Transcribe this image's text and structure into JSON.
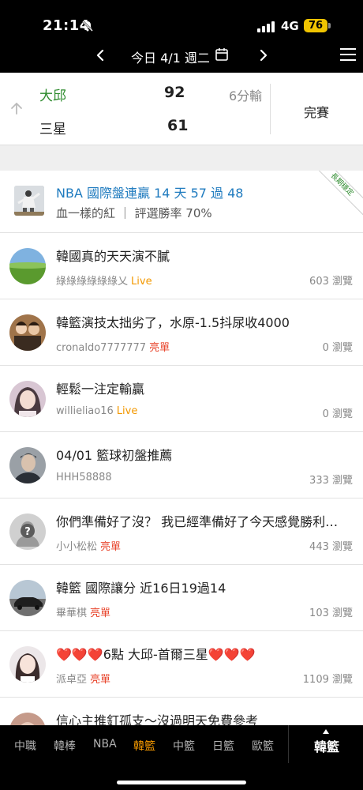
{
  "status_bar": {
    "time": "21:14",
    "network": "4G",
    "battery": "76",
    "accent": "#f0c400"
  },
  "date_nav": {
    "date_label": "今日 4/1 週二",
    "icons": [
      "chevron-left-icon",
      "calendar-icon",
      "chevron-right-icon",
      "menu-icon"
    ]
  },
  "game": {
    "team1": "大邱",
    "score1": "92",
    "team2": "三星",
    "score2": "61",
    "margin": "6分輸",
    "status": "完賽",
    "team1_color": "#2e8b2e"
  },
  "featured": {
    "title": "NBA 國際盤連贏 14 天 57 過 48",
    "subtitle": "血一樣的紅 ｜ 評選勝率 70%",
    "ribbon": "長期穩定",
    "title_color": "#1f7bbf"
  },
  "posts": [
    {
      "title": "韓國真的天天演不膩",
      "author": "綠綠綠綠綠綠乂",
      "tag": "Live",
      "tag_color": "#f39800",
      "views": "603 瀏覽"
    },
    {
      "title": "韓籃演技太拙劣了，水原-1.5抖尿收4000",
      "author": "cronaldo7777777",
      "tag": "亮單",
      "tag_color": "#e8452c",
      "views": "0 瀏覽"
    },
    {
      "title": "輕鬆一注定輸贏",
      "author": "willieliao16",
      "tag": "Live",
      "tag_color": "#f39800",
      "views": "0 瀏覽"
    },
    {
      "title": "04/01 籃球初盤推薦",
      "author": "HHH58888",
      "tag": "",
      "tag_color": "#888888",
      "views": "333 瀏覽"
    },
    {
      "title": "你們準備好了沒？  我已經準備好了今天感覺勝利…",
      "author": "小小松松",
      "tag": "亮單",
      "tag_color": "#e8452c",
      "views": "443 瀏覽"
    },
    {
      "title": "韓籃 國際讓分 近16日19過14",
      "author": "畢華棋",
      "tag": "亮單",
      "tag_color": "#e8452c",
      "views": "103 瀏覽"
    },
    {
      "title": "❤️❤️❤️6點 大邱-首爾三星❤️❤️❤️",
      "author": "派卓亞",
      "tag": "亮單",
      "tag_color": "#e8452c",
      "views": "1109 瀏覽"
    },
    {
      "title": "信心主推釘孤支～沒過明天免費參考",
      "author": "",
      "tag": "",
      "tag_color": "#888888",
      "views": ""
    }
  ],
  "tabs": [
    {
      "label": "中職",
      "active": false
    },
    {
      "label": "韓棒",
      "active": false
    },
    {
      "label": "NBA",
      "active": false
    },
    {
      "label": "韓籃",
      "active": true
    },
    {
      "label": "中籃",
      "active": false
    },
    {
      "label": "日籃",
      "active": false
    },
    {
      "label": "歐籃",
      "active": false
    }
  ],
  "current_league": "韓籃",
  "active_tab_color": "#f39800"
}
